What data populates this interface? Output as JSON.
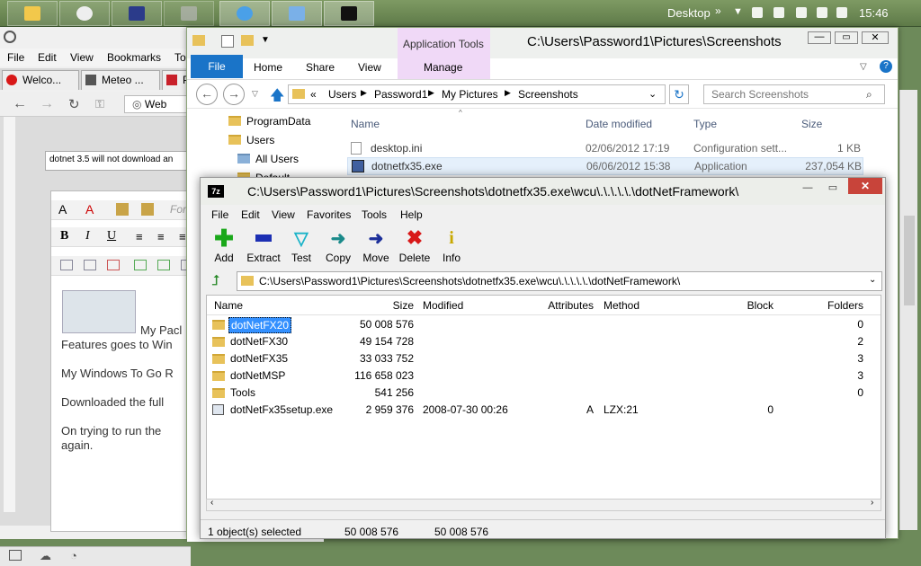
{
  "taskbar": {
    "desktop_label": "Desktop",
    "clock": "15:46",
    "buttons": [
      "explorer-icon",
      "opera-icon",
      "media-icon",
      "recycle-icon",
      "ie-icon",
      "remote-icon",
      "7zip-icon"
    ]
  },
  "browser": {
    "menu": [
      "File",
      "Edit",
      "View",
      "Bookmarks",
      "To"
    ],
    "tabs": [
      "Welco...",
      "Meteo ...",
      "P"
    ],
    "nav_web": "Web",
    "field_value": "dotnet 3.5 will not download an",
    "font_placeholder": "For",
    "editor_text": [
      "My Pacl",
      "Features goes to Win",
      "My Windows To Go R",
      "Downloaded the full",
      "On trying to run the",
      "again."
    ]
  },
  "explorer": {
    "app_tools": "Application Tools",
    "title_path": "C:\\Users\\Password1\\Pictures\\Screenshots",
    "ribbon_tabs": [
      "File",
      "Home",
      "Share",
      "View",
      "Manage"
    ],
    "address": [
      "«",
      "Users",
      "Password1",
      "My Pictures",
      "Screenshots"
    ],
    "search_placeholder": "Search Screenshots",
    "tree": [
      "ProgramData",
      "Users",
      "All Users",
      "Default"
    ],
    "columns": [
      "Name",
      "Date modified",
      "Type",
      "Size"
    ],
    "files": [
      {
        "name": "desktop.ini",
        "date": "02/06/2012 17:19",
        "type": "Configuration sett...",
        "size": "1 KB"
      },
      {
        "name": "dotnetfx35.exe",
        "date": "06/06/2012 15:38",
        "type": "Application",
        "size": "237,054 KB"
      }
    ]
  },
  "zip": {
    "title": "C:\\Users\\Password1\\Pictures\\Screenshots\\dotnetfx35.exe\\wcu\\.\\.\\.\\.\\.\\dotNetFramework\\",
    "logo": "7z",
    "menu": [
      "File",
      "Edit",
      "View",
      "Favorites",
      "Tools",
      "Help"
    ],
    "tools": [
      {
        "label": "Add",
        "color": "#1aa81a",
        "glyph": "+"
      },
      {
        "label": "Extract",
        "color": "#1c2fb3",
        "glyph": "▬"
      },
      {
        "label": "Test",
        "color": "#1ab3c8",
        "glyph": "✓"
      },
      {
        "label": "Copy",
        "color": "#1a8a8a",
        "glyph": "➜"
      },
      {
        "label": "Move",
        "color": "#1c2f9a",
        "glyph": "➜"
      },
      {
        "label": "Delete",
        "color": "#d81818",
        "glyph": "✕"
      },
      {
        "label": "Info",
        "color": "#c8a800",
        "glyph": "i"
      }
    ],
    "address": "C:\\Users\\Password1\\Pictures\\Screenshots\\dotnetfx35.exe\\wcu\\.\\.\\.\\.\\.\\dotNetFramework\\",
    "columns": [
      "Name",
      "Size",
      "Modified",
      "Attributes",
      "Method",
      "Block",
      "Folders"
    ],
    "rows": [
      {
        "name": "dotNetFX20",
        "size": "50 008 576",
        "modified": "",
        "attributes": "",
        "method": "",
        "block": "",
        "folders": "0",
        "folder": true
      },
      {
        "name": "dotNetFX30",
        "size": "49 154 728",
        "modified": "",
        "attributes": "",
        "method": "",
        "block": "",
        "folders": "2",
        "folder": true
      },
      {
        "name": "dotNetFX35",
        "size": "33 033 752",
        "modified": "",
        "attributes": "",
        "method": "",
        "block": "",
        "folders": "3",
        "folder": true
      },
      {
        "name": "dotNetMSP",
        "size": "116 658 023",
        "modified": "",
        "attributes": "",
        "method": "",
        "block": "",
        "folders": "3",
        "folder": true
      },
      {
        "name": "Tools",
        "size": "541 256",
        "modified": "",
        "attributes": "",
        "method": "",
        "block": "",
        "folders": "0",
        "folder": true
      },
      {
        "name": "dotNetFx35setup.exe",
        "size": "2 959 376",
        "modified": "2008-07-30 00:26",
        "attributes": "A",
        "method": "LZX:21",
        "block": "0",
        "folders": "",
        "folder": false
      }
    ],
    "status": [
      "1 object(s) selected",
      "50 008 576",
      "50 008 576"
    ]
  }
}
